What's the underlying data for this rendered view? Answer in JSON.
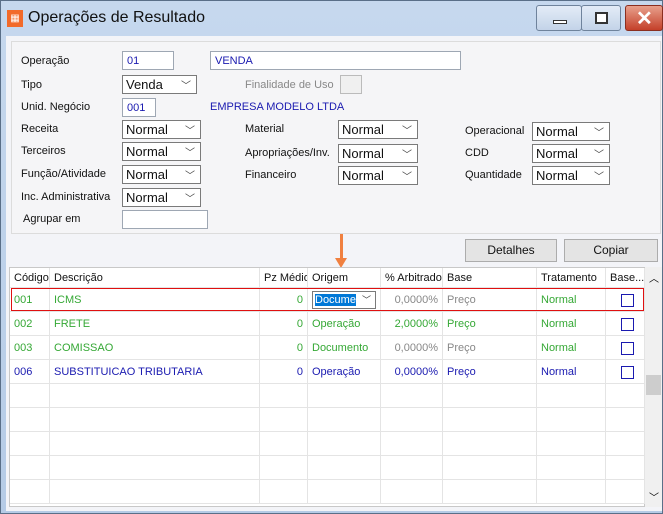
{
  "window": {
    "title": "Operações de Resultado",
    "icon": "app-icon",
    "minimize": "minimize-icon",
    "maximize": "maximize-icon",
    "close": "close-icon"
  },
  "form": {
    "operacao_label": "Operação",
    "operacao_code": "01",
    "operacao_name": "VENDA",
    "tipo_label": "Tipo",
    "tipo_value": "Venda",
    "finalidade_label": "Finalidade de Uso",
    "unid_label": "Unid. Negócio",
    "unid_code": "001",
    "unid_name": "EMPRESA MODELO LTDA",
    "receita_label": "Receita",
    "receita_value": "Normal",
    "terceiros_label": "Terceiros",
    "terceiros_value": "Normal",
    "funcao_label": "Função/Atividade",
    "funcao_value": "Normal",
    "inc_label": "Inc. Administrativa",
    "inc_value": "Normal",
    "agrupar_label": "Agrupar em",
    "agrupar_value": "",
    "material_label": "Material",
    "material_value": "Normal",
    "apropriacoes_label": "Apropriações/Inv.",
    "apropriacoes_value": "Normal",
    "financeiro_label": "Financeiro",
    "financeiro_value": "Normal",
    "operacional_label": "Operacional",
    "operacional_value": "Normal",
    "cdd_label": "CDD",
    "cdd_value": "Normal",
    "quantidade_label": "Quantidade",
    "quantidade_value": "Normal"
  },
  "buttons": {
    "detalhes": "Detalhes",
    "copiar": "Copiar"
  },
  "grid": {
    "columns": [
      "Código",
      "Descrição",
      "Pz Médio",
      "Origem",
      "% Arbitrado",
      "Base",
      "Tratamento",
      "Base..."
    ],
    "rows": [
      {
        "codigo": "001",
        "descricao": "ICMS",
        "pz": "0",
        "origem": "Docume",
        "arbitrado": "0,0000%",
        "base": "Preço",
        "tratamento": "Normal",
        "color": "#35a835"
      },
      {
        "codigo": "002",
        "descricao": "FRETE",
        "pz": "0",
        "origem": "Operação",
        "arbitrado": "2,0000%",
        "base": "Preço",
        "tratamento": "Normal",
        "color": "#35a835"
      },
      {
        "codigo": "003",
        "descricao": "COMISSAO",
        "pz": "0",
        "origem": "Documento",
        "arbitrado": "0,0000%",
        "base": "Preço",
        "tratamento": "Normal",
        "color": "#35a835"
      },
      {
        "codigo": "006",
        "descricao": "SUBSTITUICAO TRIBUTARIA",
        "pz": "0",
        "origem": "Operação",
        "arbitrado": "0,0000%",
        "base": "Preço",
        "tratamento": "Normal",
        "color": "#1a1ab0"
      }
    ]
  }
}
